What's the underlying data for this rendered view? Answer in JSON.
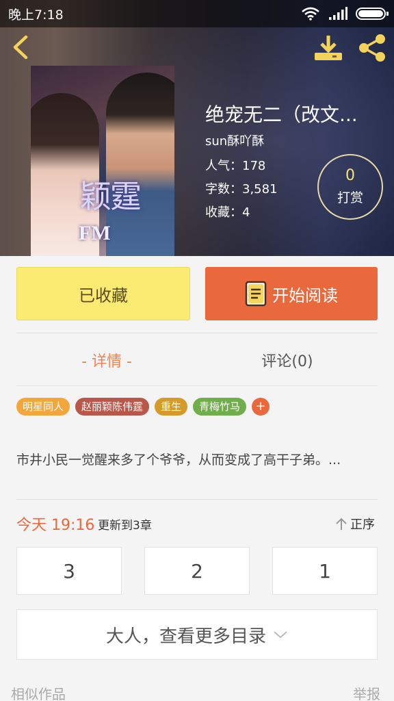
{
  "status_bar": {
    "time": "晚上7:18"
  },
  "book": {
    "title": "绝宠无二（改文...",
    "author": "sun酥吖酥",
    "popularity": "人气：178",
    "word_count": "字数：3,581",
    "favorites": "收藏：4",
    "tip_count": "0",
    "tip_label": "打赏",
    "cover_text": {
      "cn": "颖霆",
      "fm": "FM"
    }
  },
  "actions": {
    "favorited_label": "已收藏",
    "read_label": "开始阅读"
  },
  "tabs": {
    "detail": "- 详情 -",
    "comments": "评论(0)"
  },
  "tags": [
    {
      "label": "明星同人",
      "color": "#f2a63b"
    },
    {
      "label": "赵丽颖陈伟霆",
      "color": "#b9574a"
    },
    {
      "label": "重生",
      "color": "#d49a2a"
    },
    {
      "label": "青梅竹马",
      "color": "#6fae4a"
    }
  ],
  "tag_add": "+",
  "summary": "市井小民一觉醒来多了个爷爷，从而变成了高干子弟。...",
  "update": {
    "time": "今天 19:16",
    "text": "更新到3章",
    "sort_label": "正序"
  },
  "chapters": [
    "3",
    "2",
    "1"
  ],
  "more_catalog": "大人，查看更多目录",
  "footer": {
    "similar": "相似作品",
    "report": "举报"
  },
  "colors": {
    "accent": "#e9683c",
    "favorite_bg": "#fbeb73",
    "tab_active": "#ef8355"
  }
}
